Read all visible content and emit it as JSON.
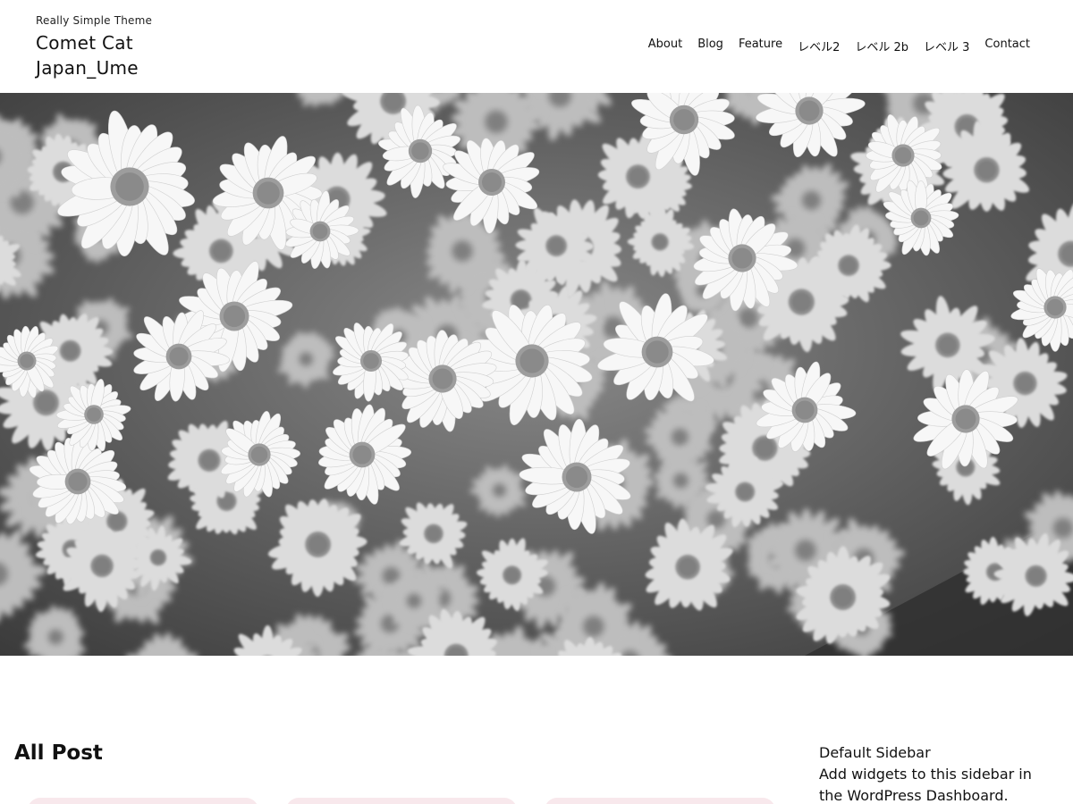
{
  "header": {
    "tagline": "Really Simple Theme",
    "site_title": "Comet Cat Japan_Ume",
    "nav": [
      "About",
      "Blog",
      "Feature",
      "レベル2",
      "レベル 2b",
      "レベル 3",
      "Contact"
    ]
  },
  "hero": {
    "alt": "black and white photo of daisy flowers"
  },
  "main": {
    "section_title": "All Post",
    "card_color": "#f8e8ec"
  },
  "sidebar": {
    "title": "Default Sidebar",
    "text": "Add widgets to this sidebar in the WordPress Dashboard."
  }
}
